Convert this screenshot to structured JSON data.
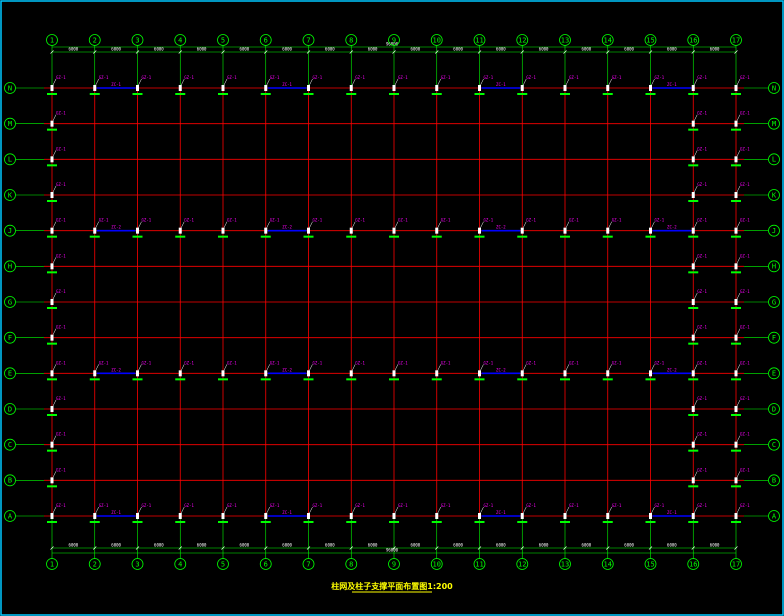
{
  "drawing": {
    "title": "柱网及柱子支撑平面布置图1:200",
    "background": "#000000",
    "border_color": "#00c8ff",
    "grid_color": "#ff0000",
    "axis_color": "#00ff00",
    "brace_color": "#0000ff",
    "tag_color": "#ff00ff",
    "column_color": "#ffffff",
    "text_color": "#ffff00"
  },
  "axes": {
    "columns": [
      "1",
      "2",
      "3",
      "4",
      "5",
      "6",
      "7",
      "8",
      "9",
      "10",
      "11",
      "12",
      "13",
      "14",
      "15",
      "16",
      "17"
    ],
    "rows": [
      "A",
      "B",
      "C",
      "D",
      "E",
      "F",
      "G",
      "H",
      "J",
      "K",
      "L",
      "M",
      "N"
    ]
  },
  "dimensions": {
    "top_bays": [
      "6000",
      "6000",
      "6000",
      "6000",
      "6000",
      "6000",
      "6000",
      "6000",
      "6000",
      "6000",
      "6000",
      "6000",
      "6000",
      "6000",
      "6000",
      "6000"
    ],
    "top_total": "96000",
    "bottom_bays": [
      "6000",
      "6000",
      "6000",
      "6000",
      "6000",
      "6000",
      "6000",
      "6000",
      "6000",
      "6000",
      "6000",
      "6000",
      "6000",
      "6000",
      "6000",
      "6000"
    ],
    "bottom_total": "96000"
  },
  "labels": {
    "column_tag": "GZ-1",
    "brace_tag": "ZC-1",
    "brace_tag_2": "ZC-2"
  }
}
